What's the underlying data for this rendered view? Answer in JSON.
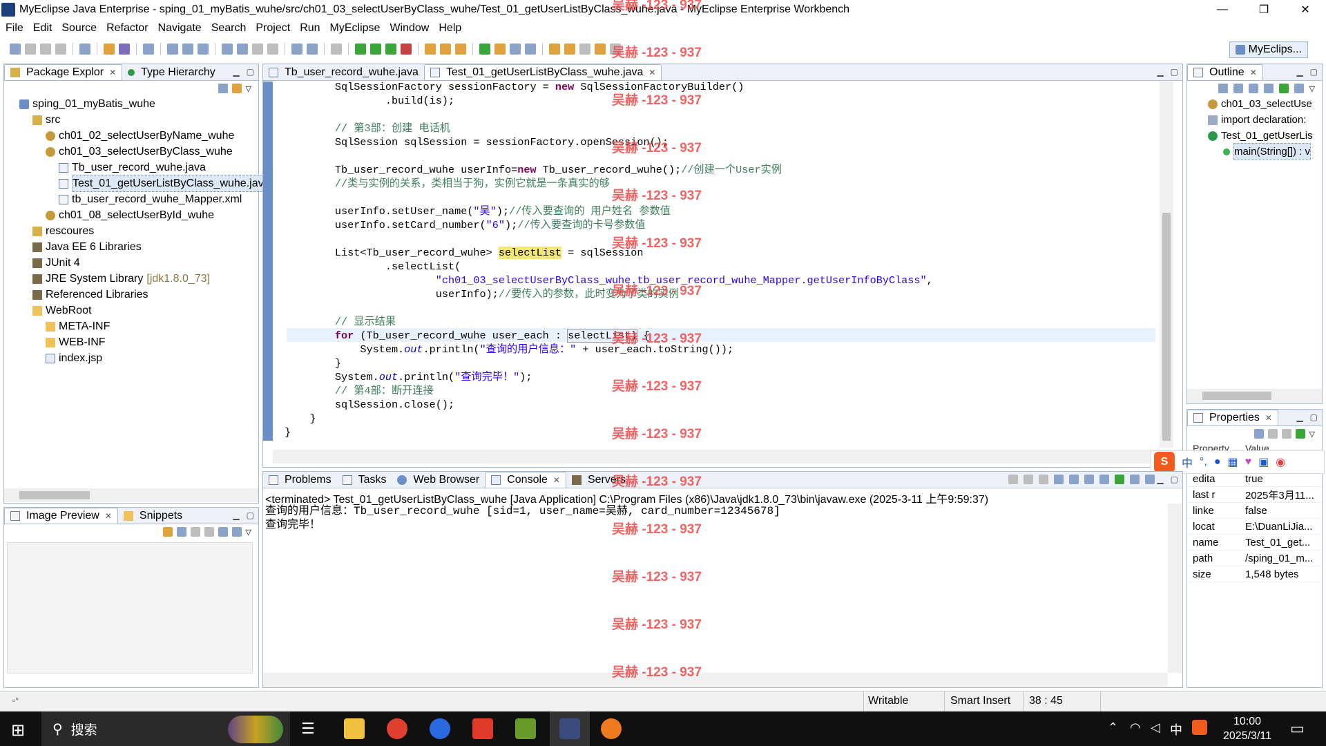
{
  "window": {
    "title": "MyEclipse Java Enterprise - sping_01_myBatis_wuhe/src/ch01_03_selectUserByClass_wuhe/Test_01_getUserListByClass_wuhe.java - MyEclipse Enterprise Workbench",
    "controls": {
      "minimize": "—",
      "restore": "❐",
      "close": "✕"
    }
  },
  "menu": [
    "File",
    "Edit",
    "Source",
    "Refactor",
    "Navigate",
    "Search",
    "Project",
    "Run",
    "MyEclipse",
    "Window",
    "Help"
  ],
  "perspective": "MyEclips...",
  "left_panel": {
    "tabs": [
      "Package Explor",
      "Type Hierarchy"
    ],
    "tree": [
      {
        "label": "sping_01_myBatis_wuhe",
        "indent": 0,
        "icon": "project-icon"
      },
      {
        "label": "src",
        "indent": 1,
        "icon": "source-folder-icon"
      },
      {
        "label": "ch01_02_selectUserByName_wuhe",
        "indent": 2,
        "icon": "package-icon"
      },
      {
        "label": "ch01_03_selectUserByClass_wuhe",
        "indent": 2,
        "icon": "package-icon"
      },
      {
        "label": "Tb_user_record_wuhe.java",
        "indent": 3,
        "icon": "java-file-icon"
      },
      {
        "label": "Test_01_getUserListByClass_wuhe.jav",
        "indent": 3,
        "icon": "java-file-icon",
        "selected": true
      },
      {
        "label": "tb_user_record_wuhe_Mapper.xml",
        "indent": 3,
        "icon": "xml-file-icon"
      },
      {
        "label": "ch01_08_selectUserById_wuhe",
        "indent": 2,
        "icon": "package-icon"
      },
      {
        "label": "rescoures",
        "indent": 1,
        "icon": "source-folder-icon"
      },
      {
        "label": "Java EE 6 Libraries",
        "indent": 1,
        "icon": "library-icon"
      },
      {
        "label": "JUnit 4",
        "indent": 1,
        "icon": "library-icon"
      },
      {
        "label": "JRE System Library",
        "suffix": "[jdk1.8.0_73]",
        "indent": 1,
        "icon": "library-icon"
      },
      {
        "label": "Referenced Libraries",
        "indent": 1,
        "icon": "library-icon"
      },
      {
        "label": "WebRoot",
        "indent": 1,
        "icon": "folder-icon"
      },
      {
        "label": "META-INF",
        "indent": 2,
        "icon": "folder-icon"
      },
      {
        "label": "WEB-INF",
        "indent": 2,
        "icon": "folder-icon"
      },
      {
        "label": "index.jsp",
        "indent": 2,
        "icon": "jsp-file-icon"
      }
    ]
  },
  "bottom_left_panel": {
    "tabs": [
      "Image Preview",
      "Snippets"
    ]
  },
  "editor": {
    "tabs": [
      "Tb_user_record_wuhe.java",
      "Test_01_getUserListByClass_wuhe.java"
    ],
    "lines": [
      "        SqlSessionFactory sessionFactory = new SqlSessionFactoryBuilder()",
      "                .build(is);",
      "",
      "        // 第3部：创建 电话机",
      "        SqlSession sqlSession = sessionFactory.openSession();",
      "",
      "        Tb_user_record_wuhe userInfo=new Tb_user_record_wuhe();//创建一个User实例",
      "        //类与实例的关系，类相当于狗，实例它就是一条真实的够",
      "",
      "        userInfo.setUser_name(\"吴\");//传入要查询的 用户姓名 参数值",
      "        userInfo.setCard_number(\"6\");//传入要查询的卡号参数值",
      "",
      "        List<Tb_user_record_wuhe> selectList = sqlSession",
      "                .selectList(",
      "                        \"ch01_03_selectUserByClass_wuhe.tb_user_record_wuhe_Mapper.getUserInfoByClass\",",
      "                        userInfo);//要传入的参数，此时变为了类的实例",
      "",
      "        // 显示结果",
      "        for (Tb_user_record_wuhe user_each : selectList) {",
      "            System.out.println(\"查询的用户信息：\" + user_each.toString());",
      "        }",
      "        System.out.println(\"查询完毕！\");",
      "        // 第4部：断开连接",
      "        sqlSession.close();",
      "    }",
      "}"
    ]
  },
  "outline": {
    "title": "Outline",
    "items": [
      {
        "label": "ch01_03_selectUse",
        "indent": 0,
        "icon": "package-icon"
      },
      {
        "label": "import declaration:",
        "indent": 0,
        "icon": "import-icon"
      },
      {
        "label": "Test_01_getUserLis",
        "indent": 0,
        "icon": "class-icon"
      },
      {
        "label": "main(String[]) : v",
        "indent": 1,
        "icon": "method-icon",
        "selected": true
      }
    ]
  },
  "properties": {
    "title": "Properties",
    "headers": [
      "Property",
      "Value"
    ],
    "rows": [
      {
        "k": "deriv",
        "v": "false"
      },
      {
        "k": "edita",
        "v": "true"
      },
      {
        "k": "last r",
        "v": "2025年3月11..."
      },
      {
        "k": "linke",
        "v": "false"
      },
      {
        "k": "locat",
        "v": "E:\\DuanLiJia..."
      },
      {
        "k": "name",
        "v": "Test_01_get..."
      },
      {
        "k": "path",
        "v": "/sping_01_m..."
      },
      {
        "k": "size",
        "v": "1,548  bytes"
      }
    ]
  },
  "console": {
    "tabs": [
      "Problems",
      "Tasks",
      "Web Browser",
      "Console",
      "Servers"
    ],
    "header": "<terminated> Test_01_getUserListByClass_wuhe [Java Application] C:\\Program Files (x86)\\Java\\jdk1.8.0_73\\bin\\javaw.exe (2025-3-11 上午9:59:37)",
    "output": [
      "查询的用户信息：Tb_user_record_wuhe [sid=1, user_name=吴赫, card_number=12345678]",
      "查询完毕！"
    ]
  },
  "watermark": "吴赫 -123 - 937",
  "status": {
    "writable": "Writable",
    "insert": "Smart Insert",
    "position": "38 : 45"
  },
  "taskbar": {
    "search": "搜索",
    "time": "10:00",
    "date": "2025/3/11",
    "ime": "中"
  },
  "ime_bar": {
    "lang": "中",
    "punct": "°,"
  }
}
